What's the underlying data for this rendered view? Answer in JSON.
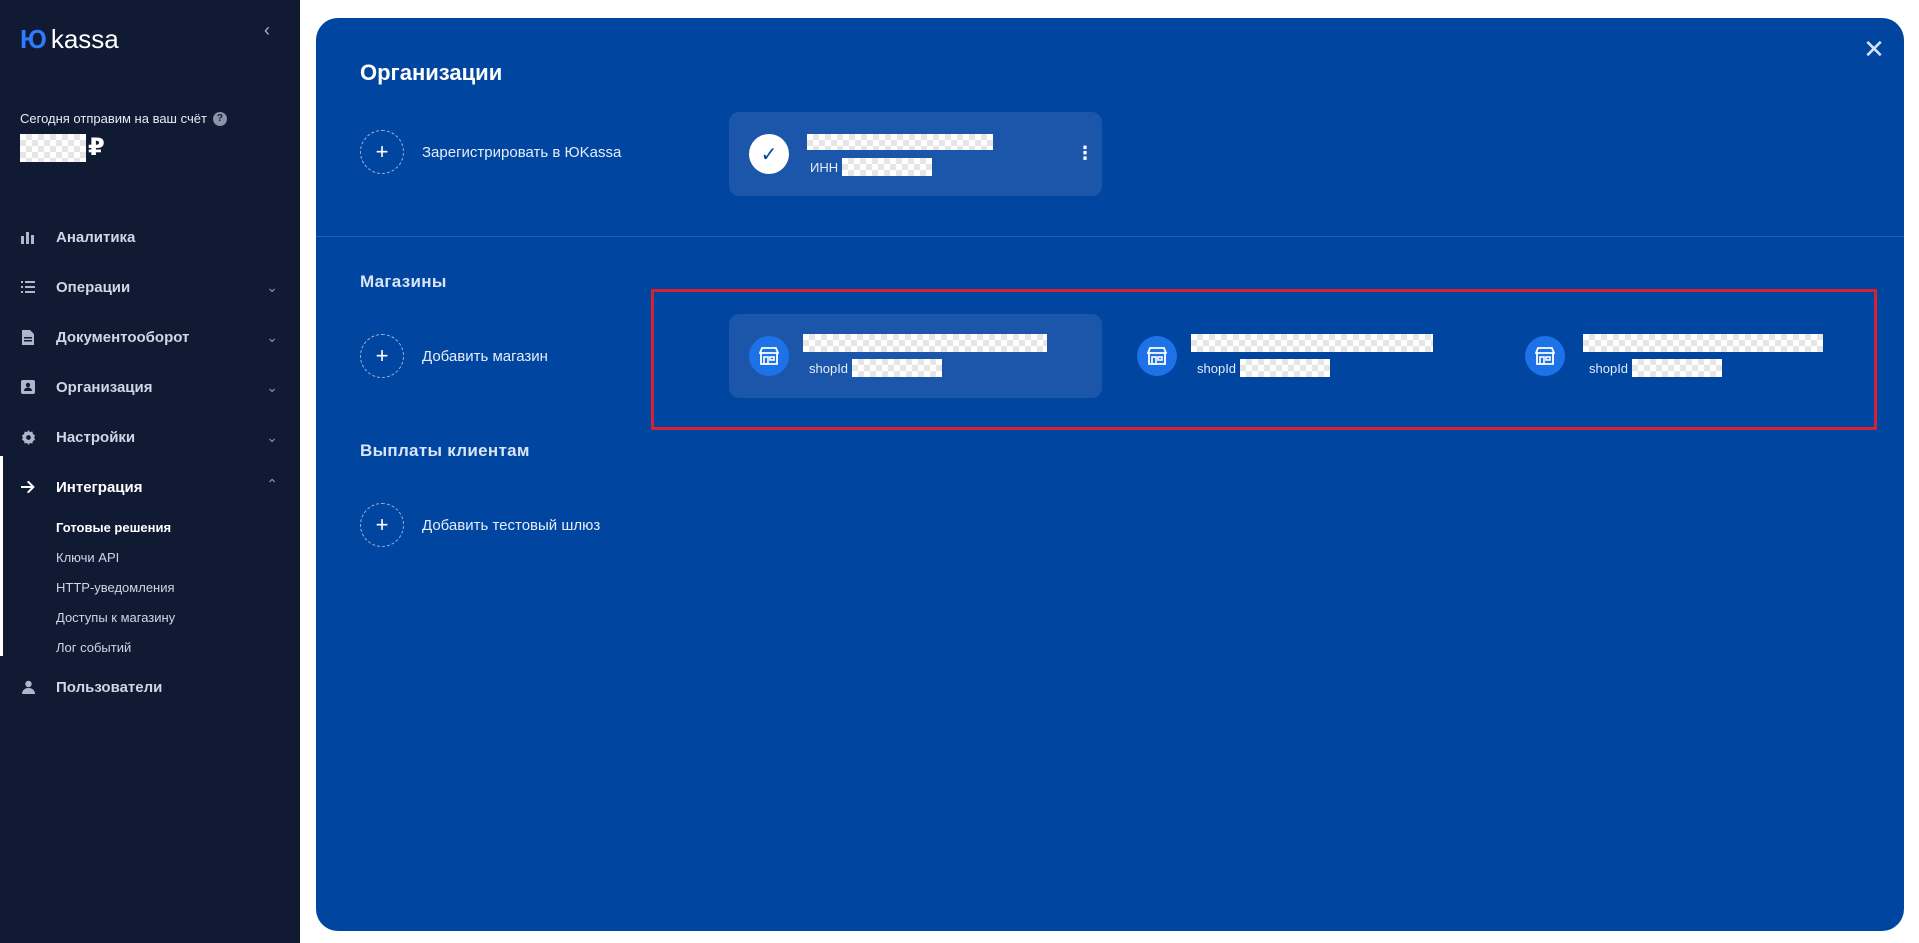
{
  "sidebar": {
    "logo_mark": "Ю",
    "logo_text": "kassa",
    "balance_label": "Сегодня отправим на ваш счёт",
    "currency": "₽",
    "nav": [
      {
        "label": "Аналитика",
        "icon": "bar-chart-icon"
      },
      {
        "label": "Операции",
        "icon": "list-icon"
      },
      {
        "label": "Документооборот",
        "icon": "document-icon"
      },
      {
        "label": "Организация",
        "icon": "id-card-icon"
      },
      {
        "label": "Настройки",
        "icon": "gear-icon"
      },
      {
        "label": "Интеграция",
        "icon": "arrow-right-icon"
      },
      {
        "label": "Пользователи",
        "icon": "user-icon"
      }
    ],
    "integration_sub": [
      "Готовые решения",
      "Ключи API",
      "HTTP-уведомления",
      "Доступы к магазину",
      "Лог событий"
    ]
  },
  "modal": {
    "title": "Организации",
    "register_label": "Зарегистрировать в ЮKassa",
    "org_inn_label": "ИНН",
    "shops_title": "Магазины",
    "add_shop_label": "Добавить магазин",
    "shop_id_label": "shopId",
    "payouts_title": "Выплаты клиентам",
    "add_gateway_label": "Добавить тестовый шлюз"
  },
  "colors": {
    "sidebar_bg": "#111a33",
    "modal_bg": "#0045a0",
    "card_bg": "#1c56aa",
    "shop_icon_bg": "#1e72e8",
    "highlight": "#d8212f"
  }
}
